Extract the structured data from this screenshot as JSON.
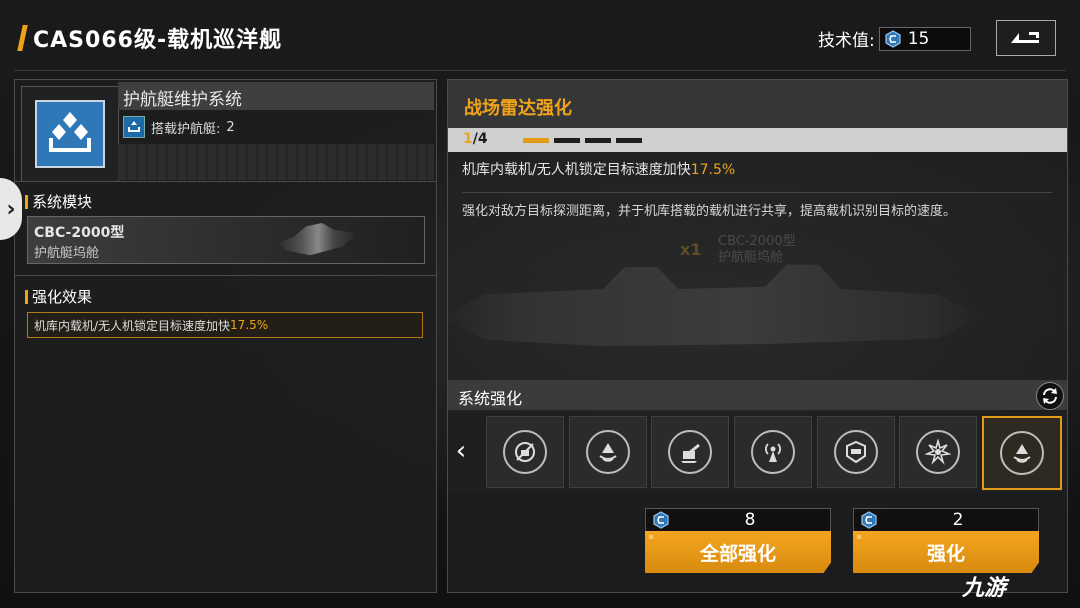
{
  "header": {
    "title": "CAS066级-载机巡洋舰",
    "tech_label": "技术值:",
    "tech_value": "15",
    "back_icon": "back-arrow-icon"
  },
  "left_panel": {
    "system_name": "护航艇维护系统",
    "carrier_label": "搭载护航艇:",
    "carrier_count": "2",
    "module_section_label": "系统模块",
    "module": {
      "name": "CBC-2000型",
      "subtitle": "护航艇坞舱"
    },
    "effect_section_label": "强化效果",
    "effect_text": "机库内载机/无人机锁定目标速度加快",
    "effect_value": "17.5%"
  },
  "right_panel": {
    "upgrade_title": "战场雷达强化",
    "progress_current": "1",
    "progress_total": "/4",
    "progress_level": 1,
    "progress_max": 4,
    "effect_text": "机库内载机/无人机锁定目标速度加快",
    "effect_value": "17.5%",
    "description": "强化对敌方目标探测距离，并于机库搭载的载机进行共享，提高载机识别目标的速度。",
    "background_module_qty": "x1",
    "background_module_name": "CBC-2000型",
    "background_module_sub": "护航艇坞舱",
    "system_upgrade_label": "系统强化",
    "slots": [
      {
        "icon": "no-hangar-icon",
        "selected": false
      },
      {
        "icon": "radar-dome-icon",
        "selected": false
      },
      {
        "icon": "turret-icon",
        "selected": false
      },
      {
        "icon": "signal-tower-icon",
        "selected": false
      },
      {
        "icon": "shield-module-icon",
        "selected": false
      },
      {
        "icon": "burst-emblem-icon",
        "selected": false
      },
      {
        "icon": "radar-dome-icon",
        "selected": true
      }
    ],
    "upgrade_all": {
      "cost": "8",
      "label": "全部强化"
    },
    "upgrade_one": {
      "cost": "2",
      "label": "强化"
    }
  },
  "watermark": "九游",
  "colors": {
    "accent": "#f0a319",
    "button": "#e39a16",
    "tech_icon": "#2f78b8"
  }
}
